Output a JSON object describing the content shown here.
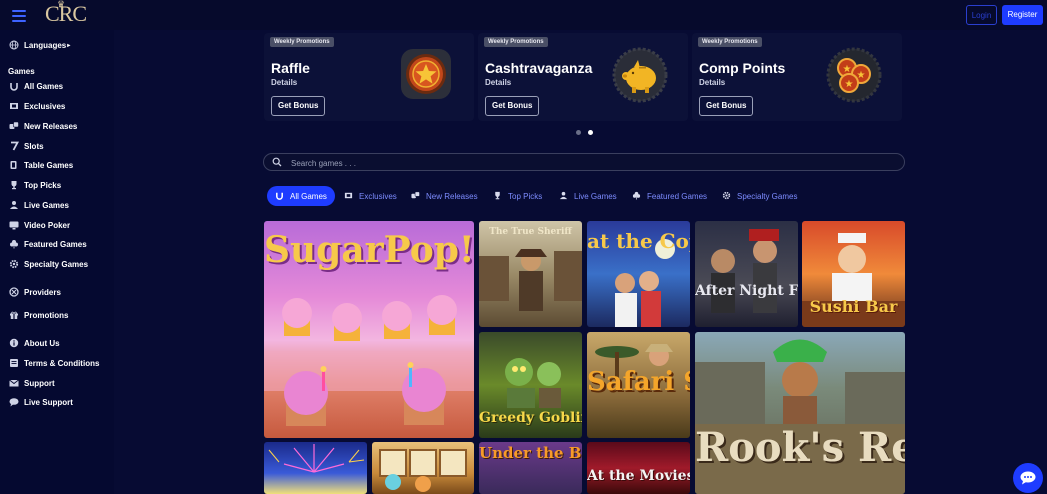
{
  "header": {
    "logo_text": "CRC",
    "login_label": "Login",
    "register_label": "Register"
  },
  "sidebar": {
    "languages_label": "Languages",
    "games_heading": "Games",
    "games": [
      {
        "label": "All Games",
        "icon": "horseshoe-icon"
      },
      {
        "label": "Exclusives",
        "icon": "exclusives-icon"
      },
      {
        "label": "New Releases",
        "icon": "dice-icon"
      },
      {
        "label": "Slots",
        "icon": "seven-icon"
      },
      {
        "label": "Table Games",
        "icon": "cards-icon"
      },
      {
        "label": "Top Picks",
        "icon": "trophy-icon"
      },
      {
        "label": "Live Games",
        "icon": "dealer-icon"
      },
      {
        "label": "Video Poker",
        "icon": "video-poker-icon"
      },
      {
        "label": "Featured Games",
        "icon": "clover-icon"
      },
      {
        "label": "Specialty Games",
        "icon": "gear-icon"
      }
    ],
    "links": [
      {
        "label": "Providers",
        "icon": "providers-icon"
      },
      {
        "label": "Promotions",
        "icon": "gift-icon"
      },
      {
        "label": "About Us",
        "icon": "info-icon"
      },
      {
        "label": "Terms & Conditions",
        "icon": "document-icon"
      },
      {
        "label": "Support",
        "icon": "mail-icon"
      },
      {
        "label": "Live Support",
        "icon": "chat-icon"
      }
    ]
  },
  "promotions": [
    {
      "tag": "Weekly Promotions",
      "title": "Raffle",
      "details": "Details",
      "button": "Get Bonus",
      "art": "star-token-icon"
    },
    {
      "tag": "Weekly Promotions",
      "title": "Cashtravaganza",
      "details": "Details",
      "button": "Get Bonus",
      "art": "piggy-bank-icon"
    },
    {
      "tag": "Weekly Promotions",
      "title": "Comp Points",
      "details": "Details",
      "button": "Get Bonus",
      "art": "coins-icon"
    }
  ],
  "carousel": {
    "pages": 2,
    "active_page": 2
  },
  "search": {
    "placeholder": "Search games . . ."
  },
  "tabs": [
    {
      "label": "All Games",
      "icon": "horseshoe-icon",
      "active": true
    },
    {
      "label": "Exclusives",
      "icon": "exclusives-icon",
      "active": false
    },
    {
      "label": "New Releases",
      "icon": "dice-icon",
      "active": false
    },
    {
      "label": "Top Picks",
      "icon": "trophy-icon",
      "active": false
    },
    {
      "label": "Live Games",
      "icon": "dealer-icon",
      "active": false
    },
    {
      "label": "Featured Games",
      "icon": "clover-icon",
      "active": false
    },
    {
      "label": "Specialty Games",
      "icon": "gear-icon",
      "active": false
    }
  ],
  "games": [
    {
      "title": "SugarPop!"
    },
    {
      "title": "The True Sheriff"
    },
    {
      "title": "at the Copa"
    },
    {
      "title": "After Night Falls"
    },
    {
      "title": "Sushi Bar"
    },
    {
      "title": "Greedy Goblins"
    },
    {
      "title": "Safari Sam"
    },
    {
      "title": "Rook's Revenge"
    },
    {
      "title": "Under the Bed"
    },
    {
      "title": "At the Movies"
    }
  ],
  "colors": {
    "background": "#070b33",
    "accent": "#1e3cff",
    "tab_text": "#7d8cff"
  }
}
